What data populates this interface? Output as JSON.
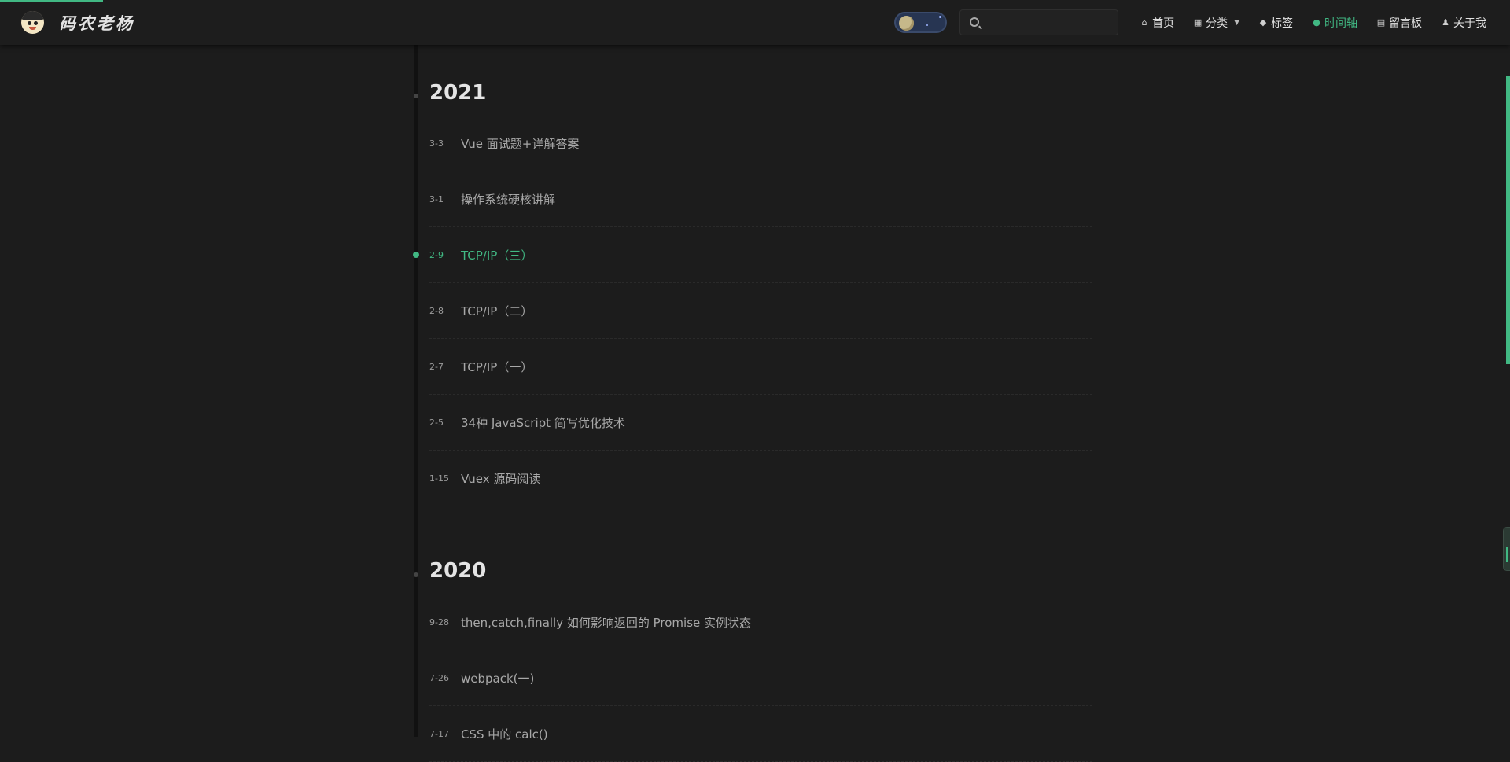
{
  "site": {
    "title": "码农老杨"
  },
  "search": {
    "placeholder": "",
    "value": ""
  },
  "nav": [
    {
      "label": "首页",
      "icon": "home-icon"
    },
    {
      "label": "分类",
      "icon": "grid-icon",
      "dropdown": true
    },
    {
      "label": "标签",
      "icon": "tag-icon"
    },
    {
      "label": "时间轴",
      "icon": "clock-icon",
      "active": true
    },
    {
      "label": "留言板",
      "icon": "message-board-icon"
    },
    {
      "label": "关于我",
      "icon": "user-icon"
    }
  ],
  "colors": {
    "accent": "#41b883",
    "background": "#1c1c1c",
    "header": "#1d1d1d"
  },
  "timeline": [
    {
      "year": "2021",
      "posts": [
        {
          "date": "3-3",
          "title": "Vue 面试题+详解答案"
        },
        {
          "date": "3-1",
          "title": "操作系统硬核讲解"
        },
        {
          "date": "2-9",
          "title": "TCP/IP（三）",
          "active": true
        },
        {
          "date": "2-8",
          "title": "TCP/IP（二）"
        },
        {
          "date": "2-7",
          "title": "TCP/IP（一）"
        },
        {
          "date": "2-5",
          "title": "34种 JavaScript 简写优化技术"
        },
        {
          "date": "1-15",
          "title": "Vuex 源码阅读"
        }
      ]
    },
    {
      "year": "2020",
      "posts": [
        {
          "date": "9-28",
          "title": "then,catch,finally 如何影响返回的 Promise 实例状态"
        },
        {
          "date": "7-26",
          "title": "webpack(一)"
        },
        {
          "date": "7-17",
          "title": "CSS 中的 calc()"
        }
      ]
    }
  ]
}
